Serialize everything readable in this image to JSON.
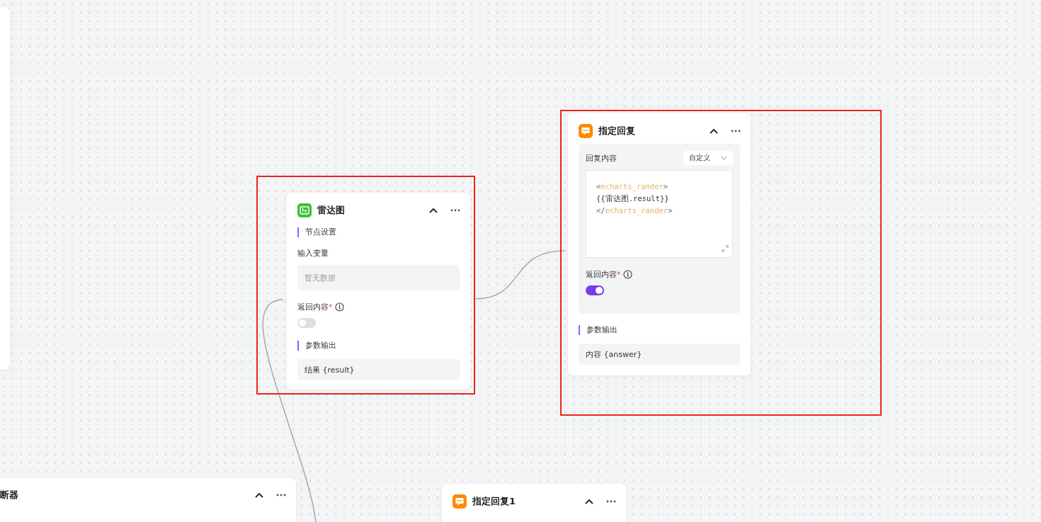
{
  "nodes": [
    {
      "kind": "function",
      "title": "雷达图",
      "highlighted": true,
      "collapsed": false,
      "sections": [
        {
          "kind": "heading",
          "text": "节点设置"
        },
        {
          "kind": "empty",
          "label": "输入变量",
          "placeholder": "暂无数据"
        },
        {
          "kind": "toggle",
          "label": "返回内容",
          "required_mark": "*",
          "on": false
        },
        {
          "kind": "heading",
          "text": "参数输出"
        },
        {
          "kind": "output",
          "text": "结果 {result}"
        }
      ]
    },
    {
      "kind": "reply",
      "title": "指定回复",
      "highlighted": true,
      "collapsed": false,
      "sections": [
        {
          "kind": "panel",
          "label": "回复内容",
          "select": "自定义",
          "code": [
            [
              {
                "kind": "punct",
                "text": "<"
              },
              {
                "kind": "tag",
                "text": "echarts_rander"
              },
              {
                "kind": "punct",
                "text": ">"
              }
            ],
            [
              {
                "kind": "text",
                "text": "{{雷达图.result}}"
              }
            ],
            [
              {
                "kind": "punct",
                "text": "</"
              },
              {
                "kind": "tag",
                "text": "echarts_rander"
              },
              {
                "kind": "punct",
                "text": ">"
              }
            ]
          ],
          "toggle": {
            "label": "返回内容",
            "required_mark": "*",
            "on": true
          }
        },
        {
          "kind": "heading",
          "text": "参数输出"
        },
        {
          "kind": "output",
          "text": "内容 {answer}"
        }
      ]
    },
    {
      "kind": "condition",
      "title": "断器",
      "highlighted": false,
      "collapsed": false
    },
    {
      "kind": "reply",
      "title": "指定回复1",
      "highlighted": false,
      "collapsed": false
    }
  ]
}
